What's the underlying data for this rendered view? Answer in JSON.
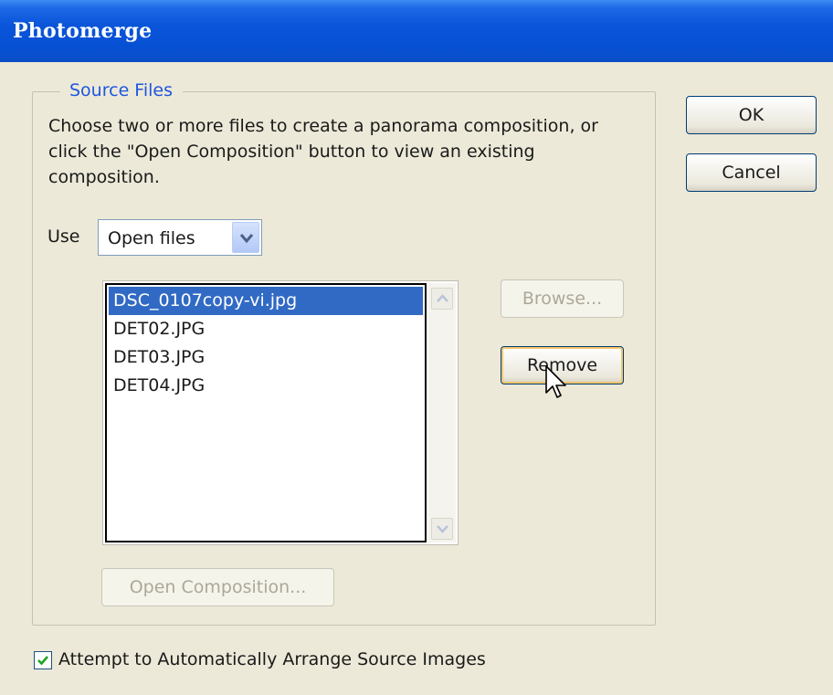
{
  "window": {
    "title": "Photomerge"
  },
  "source_files": {
    "group_label": "Source Files",
    "description": "Choose two or more files to create a panorama composition, or click the \"Open Composition\" button to view an existing composition.",
    "use_label": "Use",
    "use_select_value": "Open files",
    "files": [
      {
        "name": "DSC_0107copy-vi.jpg",
        "selected": true
      },
      {
        "name": "DET02.JPG",
        "selected": false
      },
      {
        "name": "DET03.JPG",
        "selected": false
      },
      {
        "name": "DET04.JPG",
        "selected": false
      }
    ],
    "browse_label": "Browse...",
    "remove_label": "Remove",
    "open_composition_label": "Open Composition..."
  },
  "buttons": {
    "ok_label": "OK",
    "cancel_label": "Cancel"
  },
  "options": {
    "auto_arrange_label": "Attempt to Automatically Arrange Source Images",
    "auto_arrange_checked": true
  },
  "colors": {
    "accent": "#1f56e0",
    "selection": "#316ac5",
    "titlebar": "#0a55d9"
  }
}
